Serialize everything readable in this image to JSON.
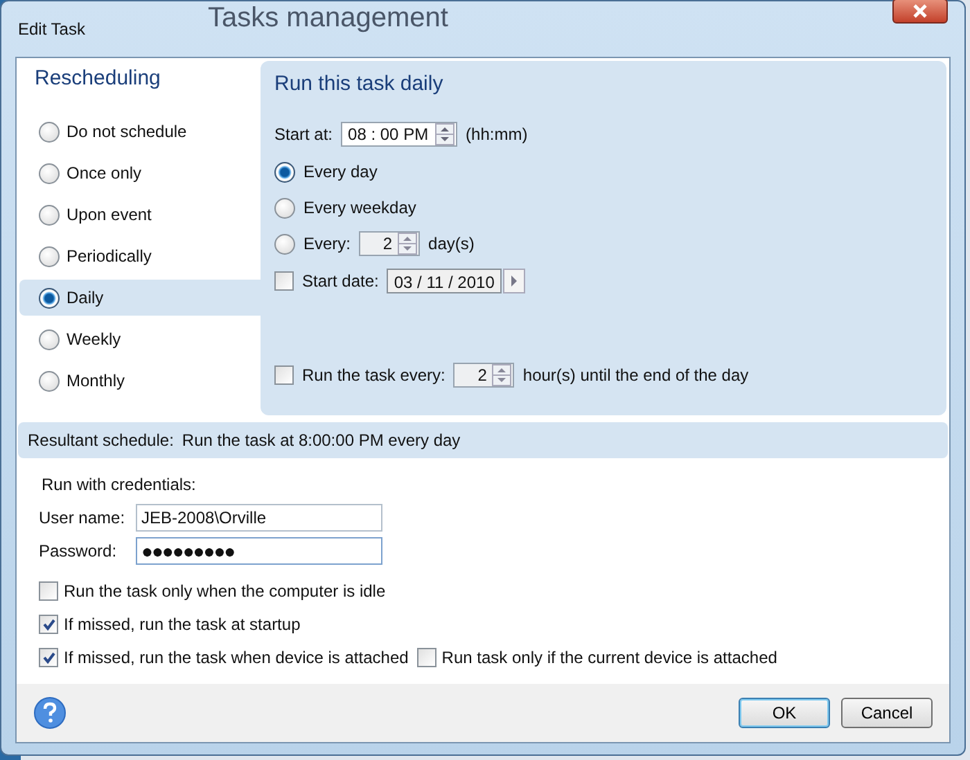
{
  "background_window": {
    "title": "Tasks management"
  },
  "window": {
    "title": "Edit Task"
  },
  "sidebar": {
    "title": "Rescheduling",
    "items": [
      {
        "label": "Do not schedule",
        "selected": false
      },
      {
        "label": "Once only",
        "selected": false
      },
      {
        "label": "Upon event",
        "selected": false
      },
      {
        "label": "Periodically",
        "selected": false
      },
      {
        "label": "Daily",
        "selected": true
      },
      {
        "label": "Weekly",
        "selected": false
      },
      {
        "label": "Monthly",
        "selected": false
      }
    ]
  },
  "panel": {
    "title": "Run this task daily",
    "start_at": {
      "label": "Start at:",
      "value": "08 : 00 PM",
      "hint": "(hh:mm)"
    },
    "frequency": [
      {
        "label": "Every day",
        "selected": true
      },
      {
        "label": "Every weekday",
        "selected": false
      },
      {
        "label": "Every:",
        "selected": false,
        "value": "2",
        "unit": "day(s)"
      }
    ],
    "start_date": {
      "label": "Start date:",
      "checked": false,
      "value": "03 / 11 / 2010"
    },
    "repeat": {
      "label": "Run the task every:",
      "checked": false,
      "value": "2",
      "unit": "hour(s) until the end of the day"
    }
  },
  "resultant": {
    "label": "Resultant schedule:",
    "text": "Run the task at 8:00:00 PM every day"
  },
  "credentials": {
    "title": "Run with credentials:",
    "user_label": "User name:",
    "user": "JEB-2008\\Orville",
    "password_label": "Password:",
    "password": "●●●●●●●●●"
  },
  "options": [
    {
      "items": [
        {
          "label": "Run the task only when the computer is idle",
          "checked": false
        }
      ]
    },
    {
      "items": [
        {
          "label": "If missed, run the task at startup",
          "checked": true
        }
      ]
    },
    {
      "items": [
        {
          "label": "If missed, run the task when device is attached",
          "checked": true
        },
        {
          "label": "Run task only if the current device is attached",
          "checked": false
        }
      ]
    }
  ],
  "buttons": [
    {
      "label": "OK",
      "default": true
    },
    {
      "label": "Cancel",
      "default": false
    }
  ]
}
